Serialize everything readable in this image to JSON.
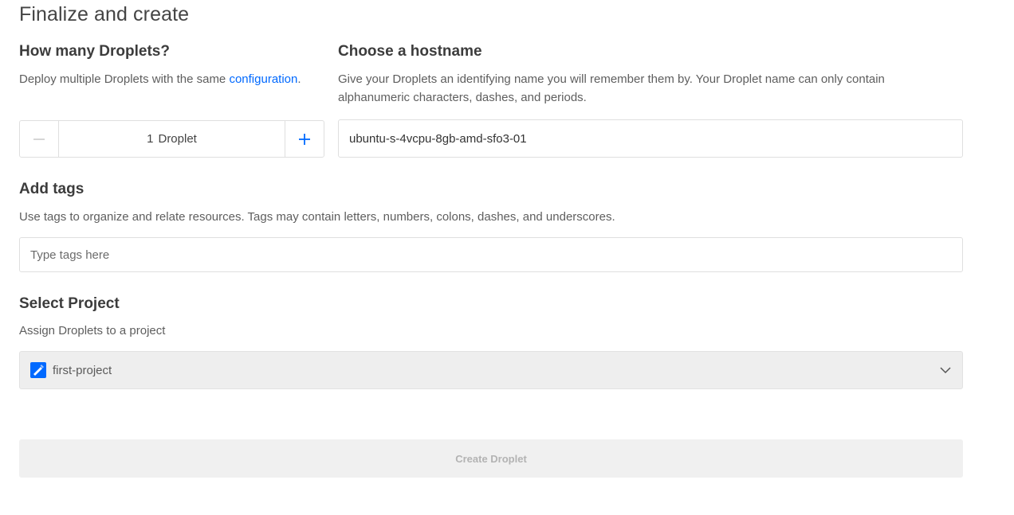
{
  "page": {
    "title": "Finalize and create"
  },
  "droplets": {
    "heading": "How many Droplets?",
    "description_prefix": "Deploy multiple Droplets with the same ",
    "description_link": "configuration",
    "description_suffix": ".",
    "count": "1",
    "unit_label": "Droplet",
    "minus_icon": "minus-icon",
    "plus_icon": "plus-icon",
    "plus_color": "#0069ff"
  },
  "hostname": {
    "heading": "Choose a hostname",
    "description": "Give your Droplets an identifying name you will remember them by. Your Droplet name can only contain alphanumeric characters, dashes, and periods.",
    "value": "ubuntu-s-4vcpu-8gb-amd-sfo3-01"
  },
  "tags": {
    "heading": "Add tags",
    "description": "Use tags to organize and relate resources. Tags may contain letters, numbers, colons, dashes, and underscores.",
    "placeholder": "Type tags here"
  },
  "project": {
    "heading": "Select Project",
    "description": "Assign Droplets to a project",
    "selected": "first-project",
    "icon": "project-icon",
    "icon_color": "#0069ff",
    "chevron_icon": "chevron-down-icon"
  },
  "actions": {
    "create_label": "Create Droplet"
  }
}
